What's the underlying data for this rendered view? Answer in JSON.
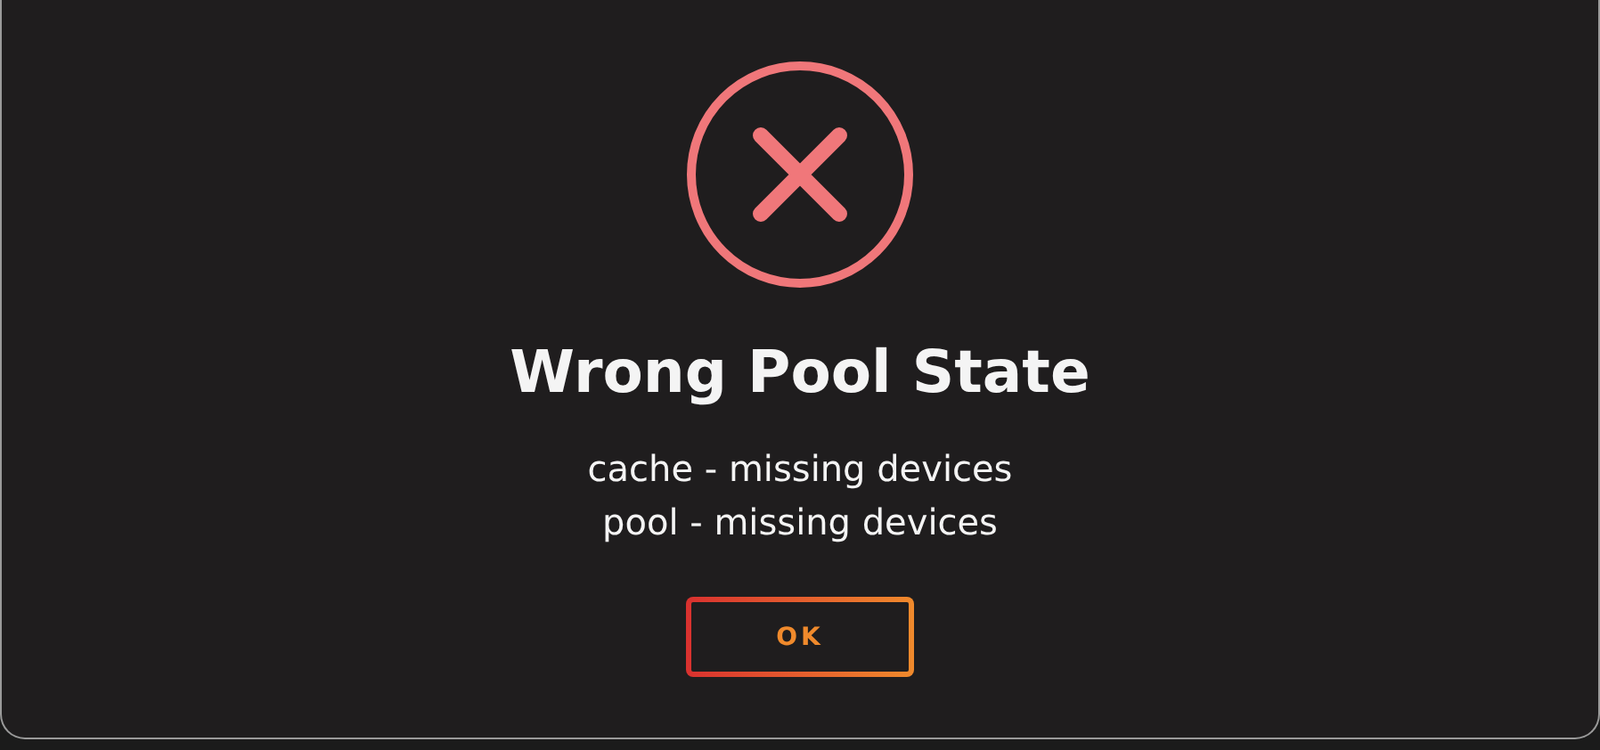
{
  "dialog": {
    "kind": "error",
    "title": "Wrong Pool State",
    "messages": [
      "cache - missing devices",
      "pool - missing devices"
    ],
    "button": "OK"
  }
}
